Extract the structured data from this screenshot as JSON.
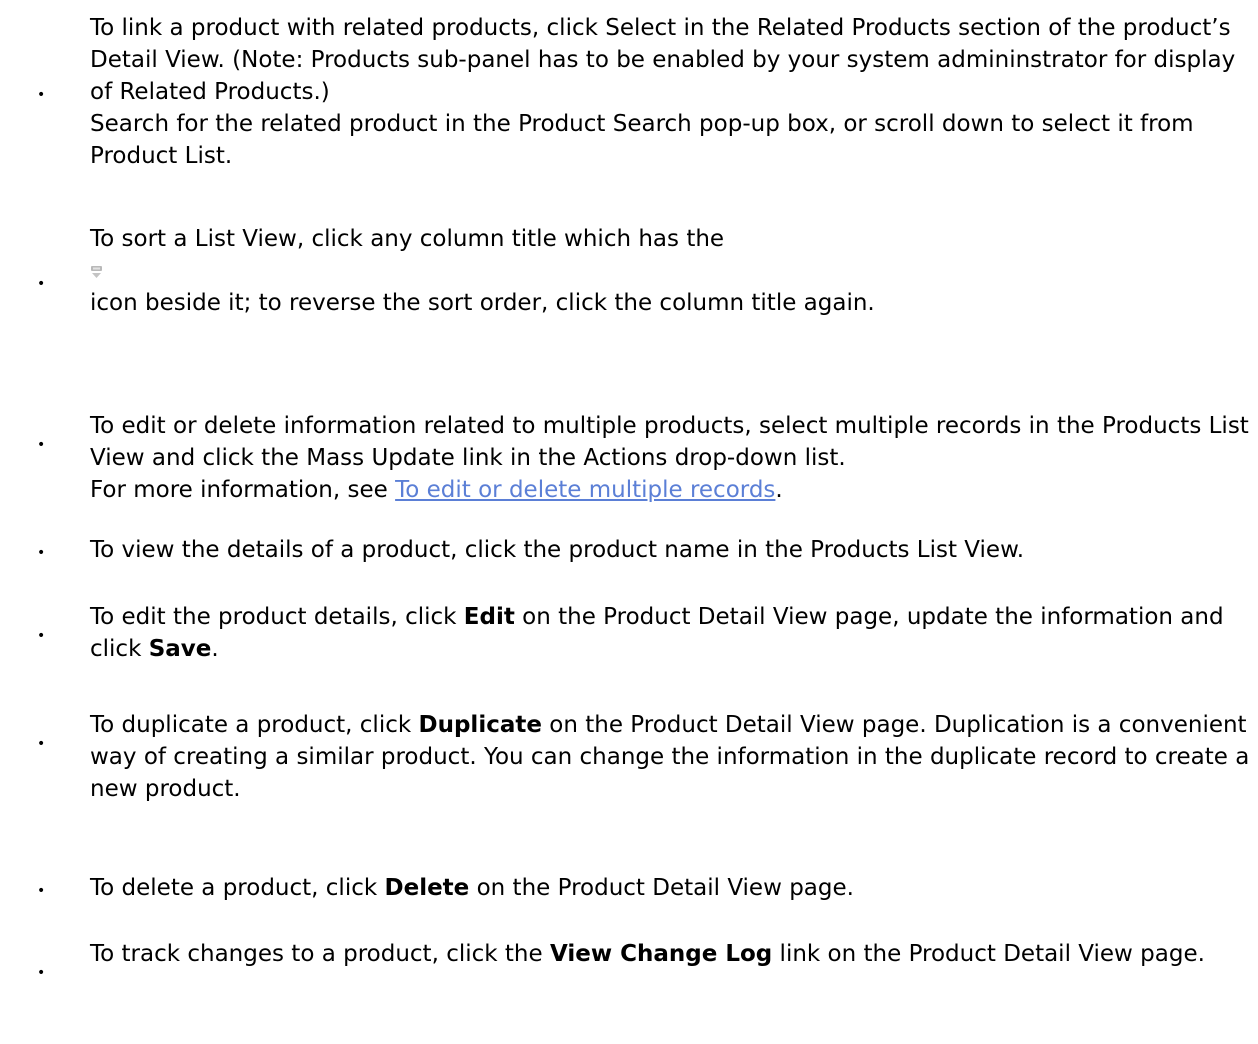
{
  "bullet_char": "•",
  "items": [
    {
      "text_1": "To link a product with related products, click Select in the Related Products section of the product’s Detail View. (Note: Products sub-panel has to be enabled by your system admininstrator for display of Related Products.)",
      "text_2": "Search for the related product in the Product Search pop-up box, or scroll down to select it from Product List."
    },
    {
      "text_1": "To sort a List View, click any column title which has the",
      "icon": "sort-icon",
      "text_2": "icon beside it; to reverse the sort order, click the column title again."
    },
    {
      "text_1": "To edit or delete information related to multiple products, select multiple records in the Products List View and click the Mass Update link in the Actions drop-down list.",
      "text_2": "For more information, see ",
      "link": "To edit or delete multiple records",
      "text_3": "."
    },
    {
      "text_1": "To view the details of a product, click the product name in the Products List View."
    },
    {
      "text_1": "To edit the product details, click ",
      "bold_1": "Edit",
      "text_2": " on the Product Detail View page, update the information and click ",
      "bold_2": "Save",
      "text_3": "."
    },
    {
      "text_1": "To duplicate a product, click ",
      "bold_1": "Duplicate",
      "text_2": " on the Product Detail View page. Duplication is a convenient way of creating a similar product. You can change the information in the duplicate record to create a new product."
    },
    {
      "text_1": "To delete a product, click ",
      "bold_1": "Delete",
      "text_2": " on the Product Detail View page."
    },
    {
      "text_1": "To track changes to a product, click the ",
      "bold_1": "View Change Log",
      "text_2": " link on the Product Detail View page."
    }
  ],
  "colors": {
    "text": "#000000",
    "link": "#5b7fd6",
    "background": "#ffffff"
  }
}
